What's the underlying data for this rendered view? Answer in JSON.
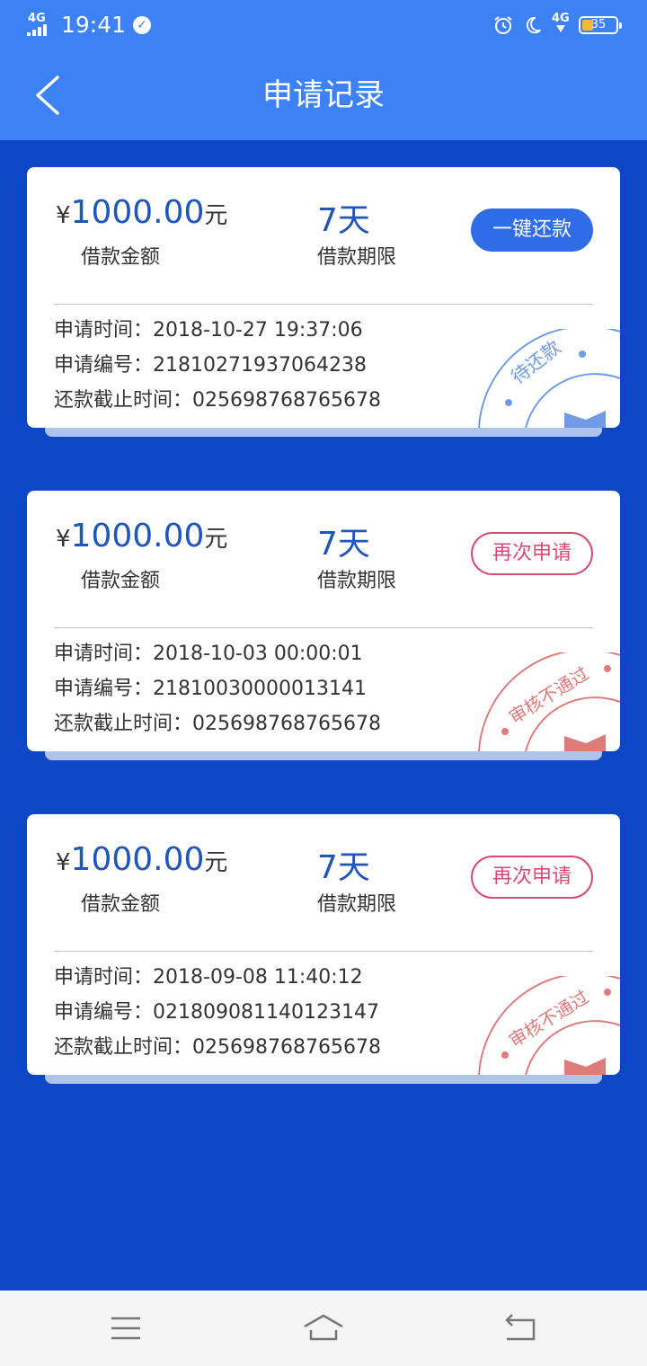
{
  "status_bar": {
    "network": "4G",
    "time": "19:41",
    "network_right": "4G",
    "battery": "35"
  },
  "header": {
    "title": "申请记录"
  },
  "colors": {
    "header": "#3d82f5",
    "background": "#0d47c8",
    "accent_blue": "#1f56b9",
    "repay_button": "#2f6de8",
    "reject_red": "#d94a70"
  },
  "records": [
    {
      "currency": "¥",
      "amount": "1000.00",
      "unit": "元",
      "amount_label": "借款金额",
      "term": "7天",
      "term_label": "借款期限",
      "action": "一键还款",
      "time_label": "申请时间：",
      "time": "2018-10-27 19:37:06",
      "no_label": "申请编号：",
      "no": "21810271937064238",
      "due_label": "还款截止时间：",
      "due": "025698768765678",
      "stamp": "待还款"
    },
    {
      "currency": "¥",
      "amount": "1000.00",
      "unit": "元",
      "amount_label": "借款金额",
      "term": "7天",
      "term_label": "借款期限",
      "action": "再次申请",
      "time_label": "申请时间：",
      "time": "2018-10-03 00:00:01",
      "no_label": "申请编号：",
      "no": "21810030000013141",
      "due_label": "还款截止时间：",
      "due": "025698768765678",
      "stamp": "审核不通过"
    },
    {
      "currency": "¥",
      "amount": "1000.00",
      "unit": "元",
      "amount_label": "借款金额",
      "term": "7天",
      "term_label": "借款期限",
      "action": "再次申请",
      "time_label": "申请时间：",
      "time": "2018-09-08 11:40:12",
      "no_label": "申请编号：",
      "no": "021809081140123147",
      "due_label": "还款截止时间：",
      "due": "025698768765678",
      "stamp": "审核不通过"
    }
  ],
  "bottom_nav": {
    "icons": [
      "menu-icon",
      "home-icon",
      "back-icon"
    ]
  }
}
